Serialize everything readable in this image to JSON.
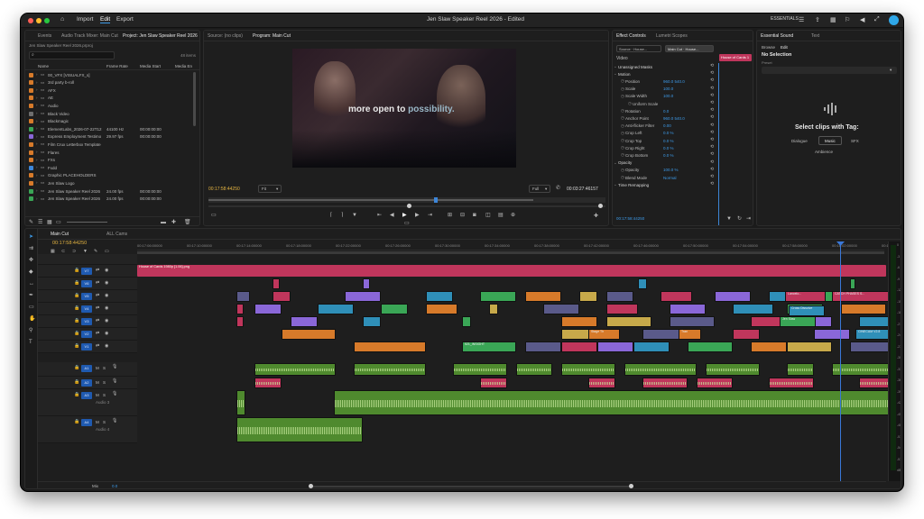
{
  "window": {
    "menu": [
      "Import",
      "Edit",
      "Export"
    ],
    "title": "Jen Slaw Speaker Reel 2026 - Edited",
    "workspace": "ESSENTIALS"
  },
  "project": {
    "tabs": [
      "Events",
      "Audio Track Mixer: Main Cut",
      "Project: Jen Slaw Speaker Reel 2026",
      "Source: (no clips)"
    ],
    "file_name": "Jen Slaw Speaker Reel 2026.prproj",
    "item_count": "48 items",
    "columns": [
      "Name",
      "Frame Rate",
      "Media Start",
      "Media En"
    ],
    "items": [
      {
        "name": "00_VFX [VISUALFX_s]",
        "rate": "",
        "start": "",
        "color": "#d77a2a"
      },
      {
        "name": "3rd party b-roll",
        "rate": "",
        "start": "",
        "color": "#d77a2a"
      },
      {
        "name": "AFX",
        "rate": "",
        "start": "",
        "color": "#d77a2a"
      },
      {
        "name": "AE",
        "rate": "",
        "start": "",
        "color": "#d77a2a"
      },
      {
        "name": "Audio",
        "rate": "",
        "start": "",
        "color": "#d77a2a"
      },
      {
        "name": "Black Video",
        "rate": "",
        "start": "",
        "color": "#6e6e6e"
      },
      {
        "name": "Blackmagic",
        "rate": "",
        "start": "",
        "color": "#d77a2a"
      },
      {
        "name": "ElementLabs_2026-07-22T12",
        "rate": "44100 Hz",
        "start": "00:00:00:00",
        "color": "#3aa656"
      },
      {
        "name": "Express Employment Testimo",
        "rate": "29.97 fps",
        "start": "00:00:00:00",
        "color": "#8a67d8"
      },
      {
        "name": "Film Crux Letterbox Template",
        "rate": "",
        "start": "",
        "color": "#d77a2a"
      },
      {
        "name": "Flares",
        "rate": "",
        "start": "",
        "color": "#d77a2a"
      },
      {
        "name": "FXs",
        "rate": "",
        "start": "",
        "color": "#d77a2a"
      },
      {
        "name": "Fxdd",
        "rate": "",
        "start": "",
        "color": "#3d86d8"
      },
      {
        "name": "Graphic PLACEHOLDERS",
        "rate": "",
        "start": "",
        "color": "#d77a2a"
      },
      {
        "name": "Jen Slaw Logo",
        "rate": "",
        "start": "",
        "color": "#d77a2a"
      },
      {
        "name": "Jen Slaw Speaker Reel 2026",
        "rate": "24.00 fps",
        "start": "00:00:00:00",
        "color": "#3aa656"
      },
      {
        "name": "Jen Slaw Speaker Reel 2026",
        "rate": "24.00 fps",
        "start": "00:00:00:00",
        "color": "#3aa656"
      }
    ]
  },
  "program": {
    "tab": "Program: Main Cut",
    "caption_part1": "more open to",
    "caption_part2": "possibility.",
    "timecode": "00:17:58:44250",
    "fit": "Fit",
    "quality": "Full",
    "duration": "00:03:27:46157"
  },
  "effects": {
    "tabs": [
      "Effect Controls",
      "Lumetri Scopes"
    ],
    "source": "Source · House...",
    "target": "Main Cut · House...",
    "clip_label": "House of Cards 1",
    "section": "Video",
    "params": [
      {
        "label": "Unassigned Masks",
        "value": ""
      },
      {
        "label": "Motion",
        "value": ""
      },
      {
        "label": "Position",
        "value": "960.0   540.0"
      },
      {
        "label": "Scale",
        "value": "100.0"
      },
      {
        "label": "Scale Width",
        "value": "100.0"
      },
      {
        "label": "Uniform Scale",
        "value": ""
      },
      {
        "label": "Rotation",
        "value": "0.0"
      },
      {
        "label": "Anchor Point",
        "value": "960.0   540.0"
      },
      {
        "label": "Anti-flicker Filter",
        "value": "0.00"
      },
      {
        "label": "Crop Left",
        "value": "0.0 %"
      },
      {
        "label": "Crop Top",
        "value": "0.0 %"
      },
      {
        "label": "Crop Right",
        "value": "0.0 %"
      },
      {
        "label": "Crop Bottom",
        "value": "0.0 %"
      },
      {
        "label": "Opacity",
        "value": ""
      },
      {
        "label": "Opacity",
        "value": "100.0 %"
      },
      {
        "label": "Blend Mode",
        "value": "Normal"
      },
      {
        "label": "Time Remapping",
        "value": ""
      }
    ],
    "timecode": "00:17:58:44250"
  },
  "essential_sound": {
    "tabs": [
      "Essential Sound",
      "Text"
    ],
    "subtabs": [
      "Browse",
      "Edit"
    ],
    "status": "No Selection",
    "preset_label": "Preset",
    "headline": "Select clips with Tag:",
    "tags": [
      "Dialogue",
      "Music",
      "SFX",
      "Ambience"
    ]
  },
  "timeline": {
    "tabs": [
      "Main Cut",
      "ALL Cams"
    ],
    "timecode": "00:17:58:44250",
    "ruler": [
      "00:17:06:00000",
      "00:17:10:00000",
      "00:17:14:00000",
      "00:17:18:00000",
      "00:17:22:00000",
      "00:17:26:00000",
      "00:17:30:00000",
      "00:17:34:00000",
      "00:17:38:00000",
      "00:17:42:00000",
      "00:17:46:00000",
      "00:17:50:00000",
      "00:17:54:00000",
      "00:17:58:00000",
      "00:18:02:00000",
      "00:18:06:00000"
    ],
    "video_tracks": [
      "V7",
      "V6",
      "V5",
      "V4",
      "V3",
      "V2",
      "V1"
    ],
    "audio_tracks": [
      "A1",
      "A2",
      "A3",
      "A4"
    ],
    "audio_names": [
      "",
      "",
      "Audio 3",
      "Audio 4"
    ],
    "mix": "Mix",
    "mix_value": "0.0",
    "title_clip": "House of Cards 1980p [1.06].png",
    "clips": [
      "Lancelo...",
      "CATCH PHASES S...",
      "Cross Dissolve",
      "Jen Slaw",
      "CINECAM V2.8",
      "521_INSIGHT",
      "Stage Th",
      "Tran"
    ],
    "meter": [
      "0",
      "-3",
      "-6",
      "-9",
      "-12",
      "-15",
      "-18",
      "-21",
      "-24",
      "-27",
      "-30",
      "-33",
      "-36",
      "-39",
      "-42",
      "-45",
      "-48",
      "-51",
      "-54",
      "-57",
      "dB"
    ]
  }
}
